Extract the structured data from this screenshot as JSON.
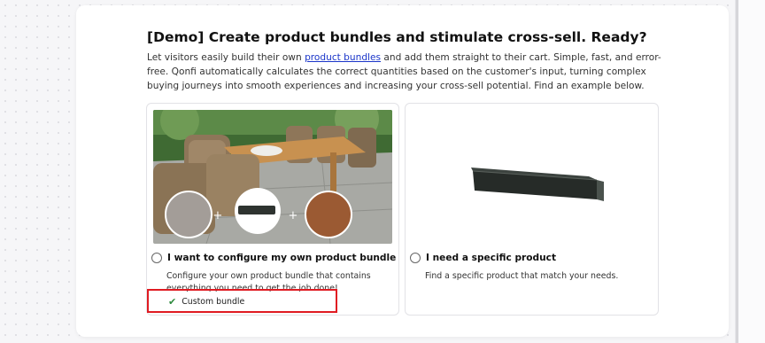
{
  "page": {
    "title": "[Demo] Create product bundles and stimulate cross-sell. Ready?",
    "description_before_link": "Let visitors easily build their own ",
    "description_link": "product bundles",
    "description_after_link": " and add them straight to their cart. Simple, fast, and error-free. Qonfi automatically calculates the correct quantities based on the customer's input, turning complex buying journeys into smooth experiences and increasing your cross-sell potential. Find an example below."
  },
  "options": [
    {
      "label": "I want to configure my own product bundle",
      "description": "Configure your own product bundle that contains everything you need to get the job done!",
      "badge": "Custom bundle",
      "image": "garden-patio-furniture-with-bundle-items"
    },
    {
      "label": "I need a specific product",
      "description": "Find a specific product that match your needs.",
      "image": "dark-concrete-curb-stone"
    }
  ],
  "icons": {
    "badge": "check-icon",
    "bundle_joiner": "+"
  },
  "colors": {
    "link": "#1a35c9",
    "check": "#2e8a3e",
    "highlight": "#e01b22"
  }
}
